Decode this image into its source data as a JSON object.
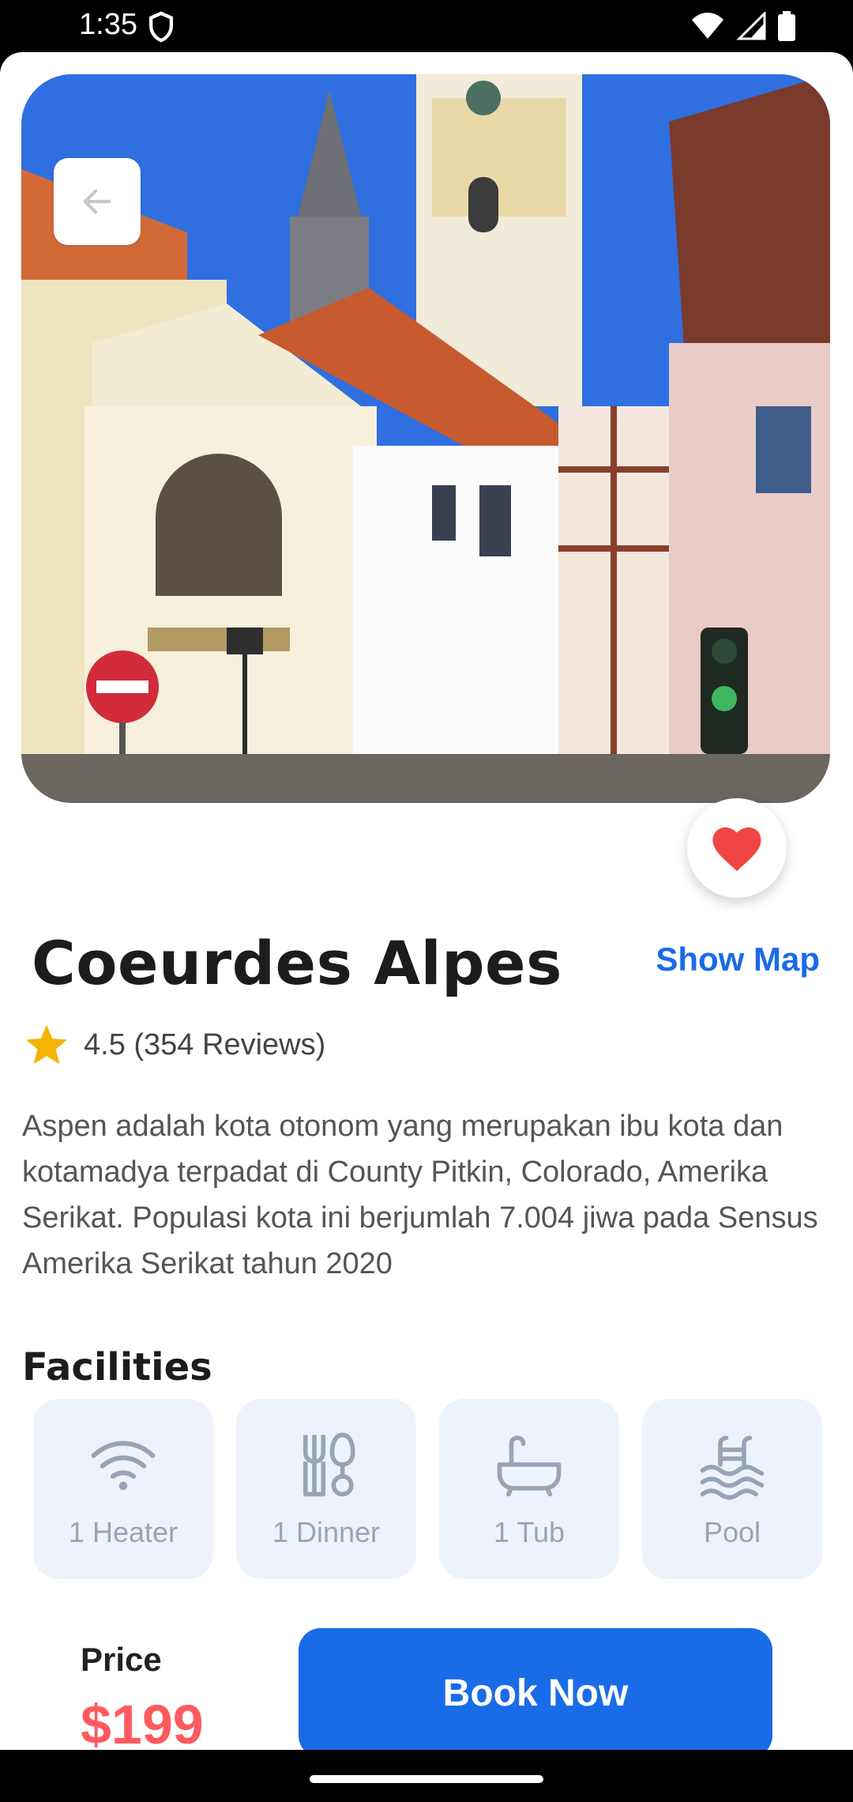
{
  "status_bar": {
    "time": "1:35",
    "icons": [
      "shield-icon",
      "wifi-icon",
      "signal-icon",
      "battery-icon"
    ]
  },
  "hero": {
    "image": "town-square-photo",
    "back_icon": "arrow-left-icon",
    "favorite_icon": "heart-icon",
    "favorite_color": "#f04545"
  },
  "place": {
    "title": "Coeurdes Alpes",
    "show_map": "Show Map",
    "rating_text": "4.5 (354 Reviews)",
    "description": "Aspen adalah kota otonom yang merupakan ibu kota dan kotamadya terpadat di County Pitkin, Colorado, Amerika Serikat. Populasi kota ini berjumlah 7.004 jiwa pada Sensus Amerika Serikat tahun 2020"
  },
  "facilities": {
    "title": "Facilities",
    "items": [
      {
        "label": "1 Heater",
        "icon": "wifi-icon"
      },
      {
        "label": "1 Dinner",
        "icon": "dinner-icon"
      },
      {
        "label": "1 Tub",
        "icon": "bathtub-icon"
      },
      {
        "label": "Pool",
        "icon": "pool-icon"
      }
    ]
  },
  "booking": {
    "price_label": "Price",
    "price": "$199",
    "button": "Book Now"
  },
  "colors": {
    "accent": "#1a6be8",
    "price": "#ff5a5f",
    "star": "#f5b301",
    "card_bg": "#eef3fb"
  }
}
